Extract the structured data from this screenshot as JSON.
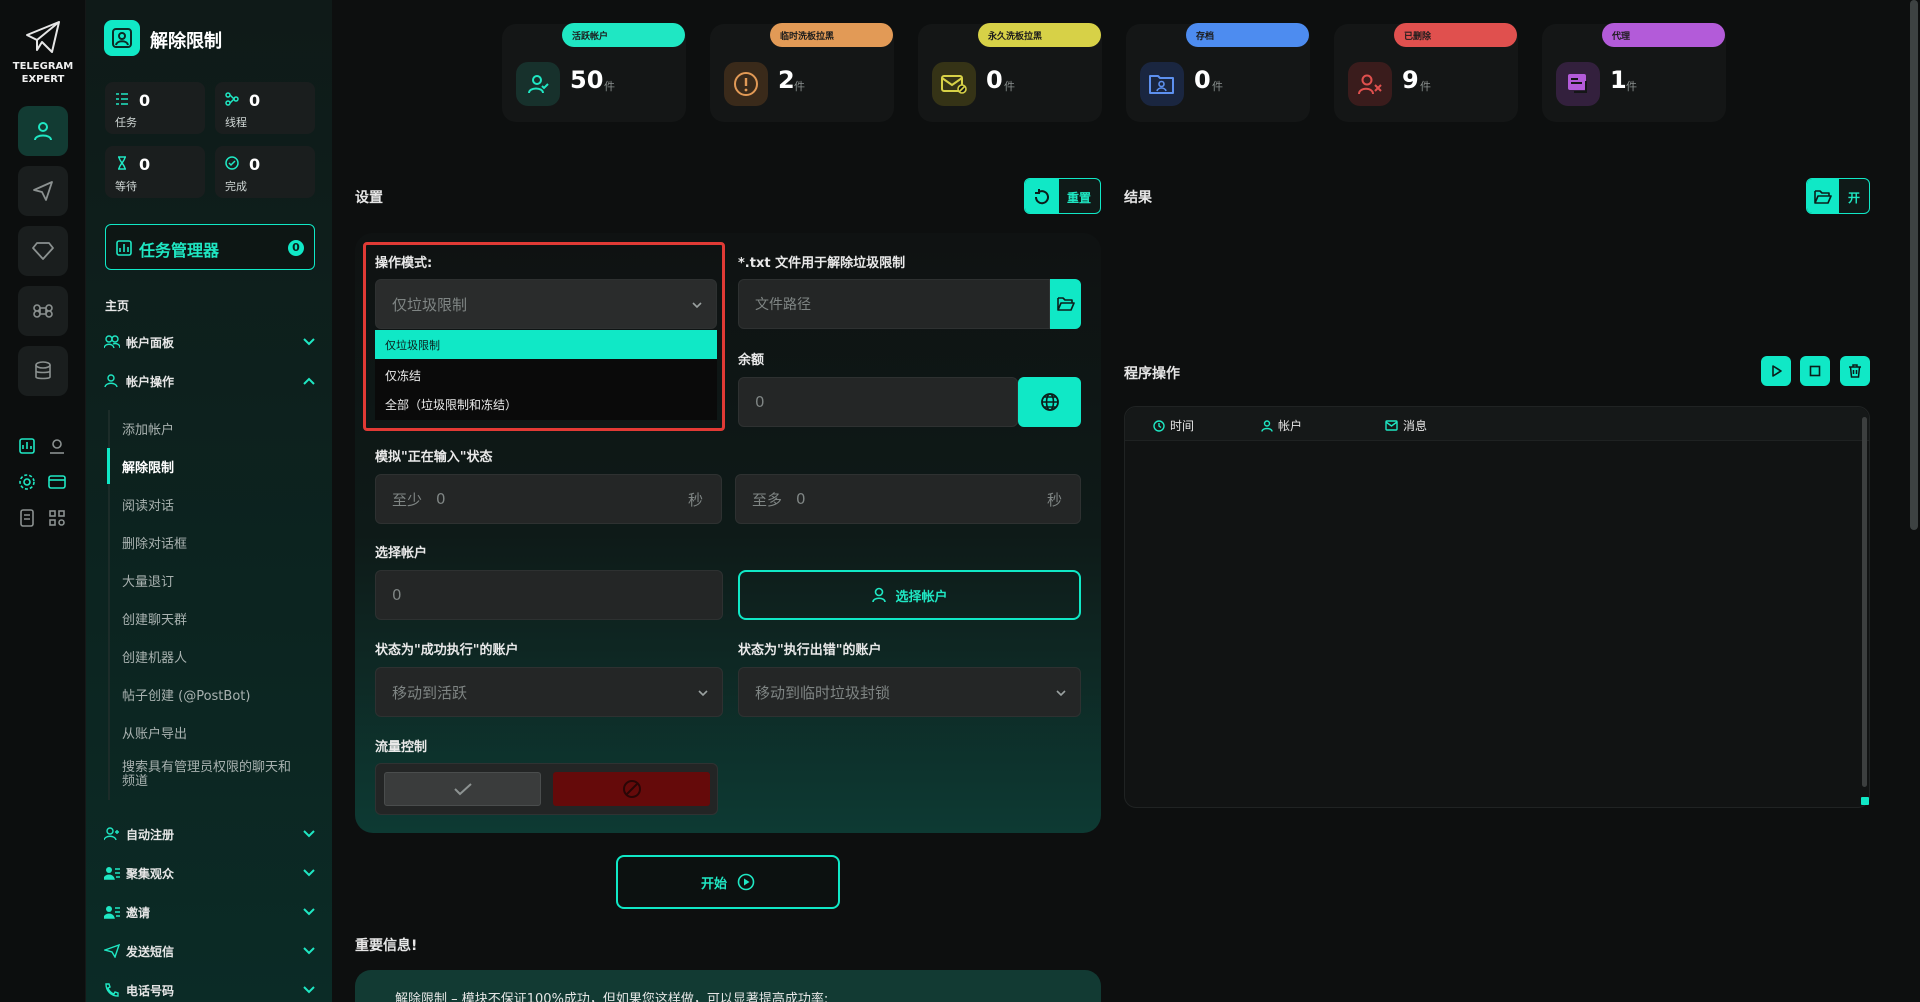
{
  "app": {
    "logo_line1": "TELEGRAM",
    "logo_line2": "EXPERT",
    "module_title": "解除限制"
  },
  "sidebar_stats": [
    {
      "value": "0",
      "label": "任务",
      "icon": "tasks-icon"
    },
    {
      "value": "0",
      "label": "线程",
      "icon": "threads-icon"
    },
    {
      "value": "0",
      "label": "等待",
      "icon": "hourglass-icon"
    },
    {
      "value": "0",
      "label": "完成",
      "icon": "check-circle-icon"
    }
  ],
  "task_manager": {
    "label": "任务管理器",
    "count": "0"
  },
  "nav": {
    "home": "主页",
    "account_panel": "帐户面板",
    "account_ops": "帐户操作",
    "sub_items": [
      "添加帐户",
      "解除限制",
      "阅读对话",
      "删除对话框",
      "大量退订",
      "创建聊天群",
      "创建机器人",
      "帖子创建 (@PostBot)",
      "从账户导出",
      "搜索具有管理员权限的聊天和频道"
    ],
    "active_sub": "解除限制",
    "auto_register": "自动注册",
    "audience": "聚集观众",
    "invite": "邀请",
    "send_sms": "发送短信",
    "phone_number": "电话号码"
  },
  "kpis": [
    {
      "tag": "活跃帐户",
      "value": "50",
      "unit": "件",
      "color": "#1fe7c3",
      "icon": "user-icon",
      "icon_bg": "#17312c",
      "icon_color": "#1fe7c3"
    },
    {
      "tag": "临时洗板拉黑",
      "value": "2",
      "unit": "件",
      "color": "#e29a56",
      "icon": "warning-icon",
      "icon_bg": "#3a2a1a",
      "icon_color": "#e29a56"
    },
    {
      "tag": "永久洗板拉黑",
      "value": "0",
      "unit": "件",
      "color": "#d7d147",
      "icon": "mail-ban-icon",
      "icon_bg": "#353316",
      "icon_color": "#d7d147"
    },
    {
      "tag": "存档",
      "value": "0",
      "unit": "件",
      "color": "#4d8cf0",
      "icon": "folder-user-icon",
      "icon_bg": "#1a2640",
      "icon_color": "#5d90ef"
    },
    {
      "tag": "已删除",
      "value": "9",
      "unit": "件",
      "color": "#e0504e",
      "icon": "user-x-icon",
      "icon_bg": "#3a1c1c",
      "icon_color": "#e0504e"
    },
    {
      "tag": "代理",
      "value": "1",
      "unit": "件",
      "color": "#b35bd9",
      "icon": "proxy-icon",
      "icon_bg": "#33203d",
      "icon_color": "#b35bd9"
    }
  ],
  "settings": {
    "title": "设置",
    "reset": "重置",
    "op_mode_label": "操作模式:",
    "op_mode_value": "仅垃圾限制",
    "op_mode_options": [
      "仅垃圾限制",
      "仅冻结",
      "全部（垃圾限制和冻结）"
    ],
    "txt_label": "*.txt 文件用于解除垃圾限制",
    "txt_placeholder": "文件路径",
    "balance_label": "余额",
    "balance_value": "0",
    "typing_label": "模拟\"正在输入\"状态",
    "min_prefix": "至少",
    "min_value": "0",
    "max_prefix": "至多",
    "max_value": "0",
    "seconds": "秒",
    "select_account_label": "选择帐户",
    "select_account_value": "0",
    "select_account_btn": "选择帐户",
    "success_label": "状态为\"成功执行\"的账户",
    "success_value": "移动到活跃",
    "error_label": "状态为\"执行出错\"的账户",
    "error_value": "移动到临时垃圾封锁",
    "flow_label": "流量控制",
    "start": "开始",
    "important_title": "重要信息!",
    "important_text": "解除限制 – 模块不保证100%成功，但如果您这样做，可以显著提高成功率:"
  },
  "results": {
    "title": "结果",
    "open": "开",
    "program_ops": "程序操作",
    "col_time": "时间",
    "col_account": "帐户",
    "col_message": "消息"
  },
  "colors": {
    "accent": "#10e8c6",
    "danger_frame": "#e03a35",
    "blocked": "#650a0a"
  }
}
